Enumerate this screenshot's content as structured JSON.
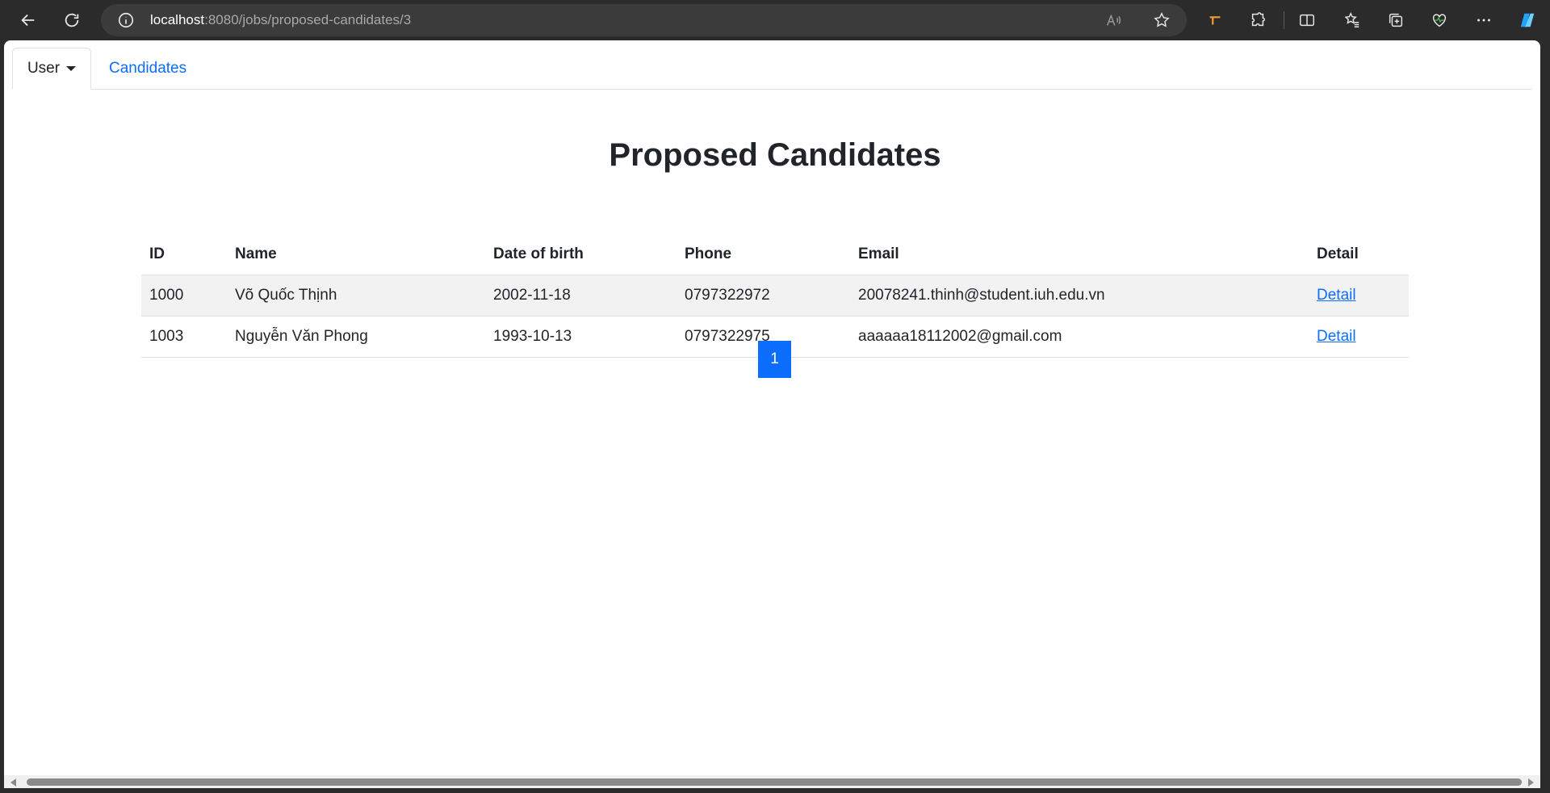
{
  "browser": {
    "url_host": "localhost",
    "url_rest": ":8080/jobs/proposed-candidates/3"
  },
  "nav": {
    "user_tab": "User",
    "candidates_tab": "Candidates"
  },
  "page": {
    "title": "Proposed Candidates"
  },
  "table": {
    "headers": {
      "id": "ID",
      "name": "Name",
      "dob": "Date of birth",
      "phone": "Phone",
      "email": "Email",
      "detail": "Detail"
    },
    "rows": [
      {
        "id": "1000",
        "name": "Võ Quốc Thịnh",
        "dob": "2002-11-18",
        "phone": "0797322972",
        "email": "20078241.thinh@student.iuh.edu.vn",
        "detail": "Detail"
      },
      {
        "id": "1003",
        "name": "Nguyễn Văn Phong",
        "dob": "1993-10-13",
        "phone": "0797322975",
        "email": "aaaaaa18112002@gmail.com",
        "detail": "Detail"
      }
    ]
  },
  "pagination": {
    "current": "1"
  },
  "colors": {
    "accent": "#0d6efd",
    "chrome": "#2b2b2b",
    "text": "#212529"
  }
}
